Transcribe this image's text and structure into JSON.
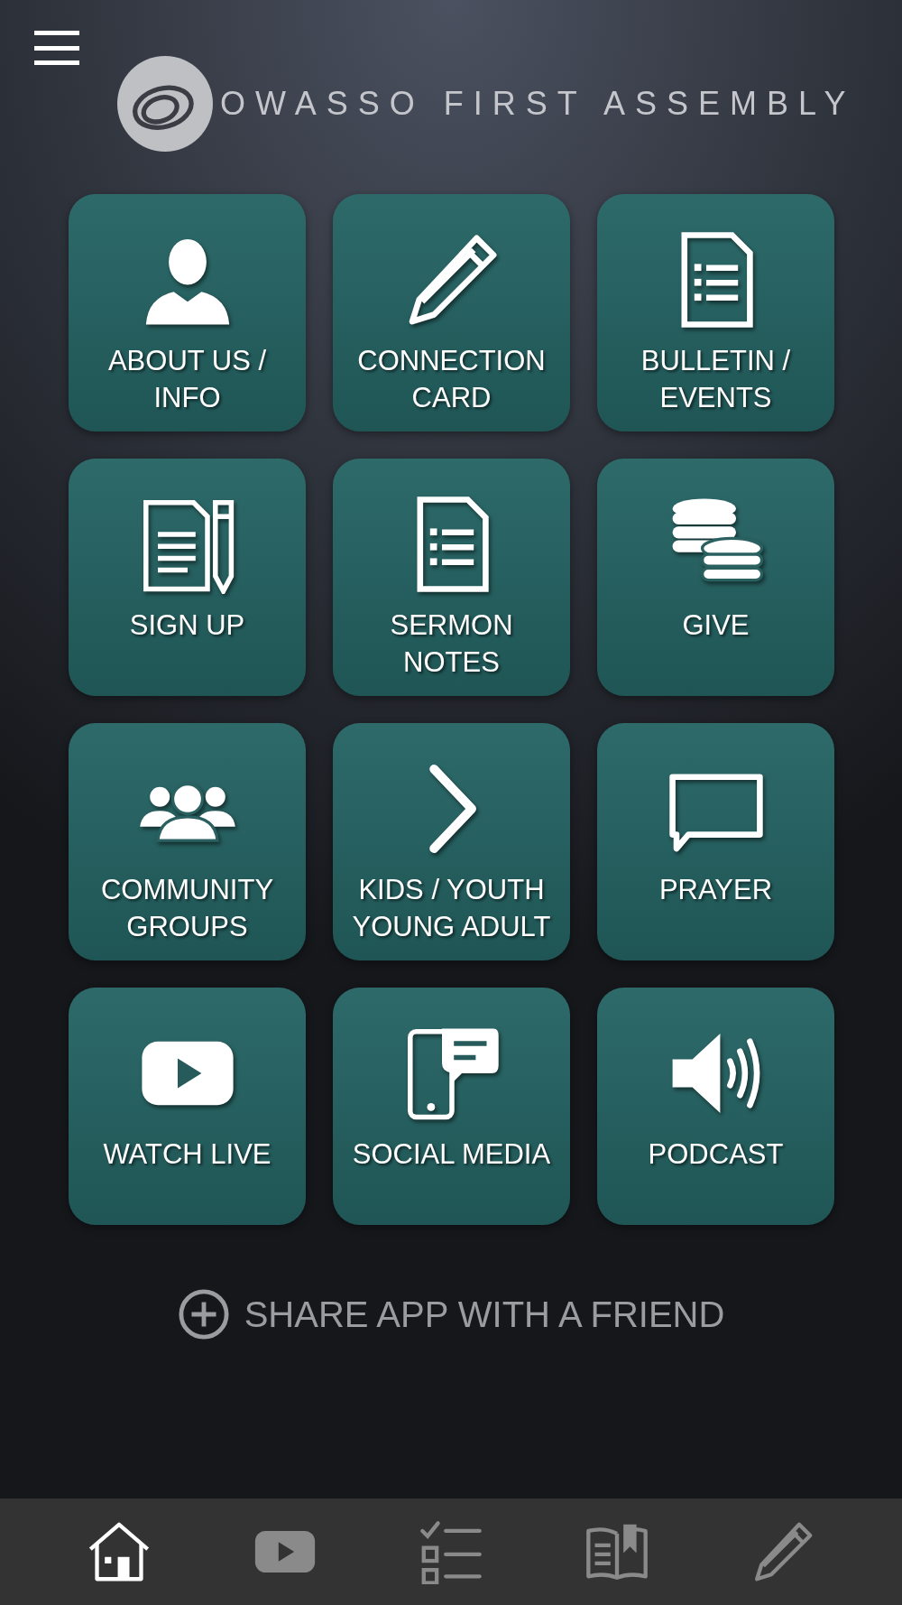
{
  "header": {
    "title": "OWASSO FIRST ASSEMBLY"
  },
  "tiles": [
    {
      "kind": "person",
      "label": [
        "ABOUT US /",
        "INFO"
      ]
    },
    {
      "kind": "pencil",
      "label": [
        "CONNECTION",
        "CARD"
      ]
    },
    {
      "kind": "document",
      "label": [
        "BULLETIN /",
        "EVENTS"
      ]
    },
    {
      "kind": "signup",
      "label": [
        "SIGN UP"
      ]
    },
    {
      "kind": "document",
      "label": [
        "SERMON",
        "NOTES"
      ]
    },
    {
      "kind": "coins",
      "label": [
        "GIVE"
      ]
    },
    {
      "kind": "people",
      "label": [
        "COMMUNITY",
        "GROUPS"
      ]
    },
    {
      "kind": "chevron",
      "label": [
        "KIDS / YOUTH",
        "YOUNG ADULT"
      ]
    },
    {
      "kind": "bubble",
      "label": [
        "PRAYER"
      ]
    },
    {
      "kind": "play",
      "label": [
        "WATCH LIVE"
      ]
    },
    {
      "kind": "phone",
      "label": [
        "SOCIAL MEDIA"
      ]
    },
    {
      "kind": "speaker",
      "label": [
        "PODCAST"
      ]
    }
  ],
  "share": {
    "label": "SHARE APP WITH A FRIEND"
  },
  "tabbar": [
    {
      "kind": "home",
      "selected": true
    },
    {
      "kind": "play",
      "selected": false
    },
    {
      "kind": "checklist",
      "selected": false
    },
    {
      "kind": "book",
      "selected": false
    },
    {
      "kind": "pencil",
      "selected": false
    }
  ]
}
